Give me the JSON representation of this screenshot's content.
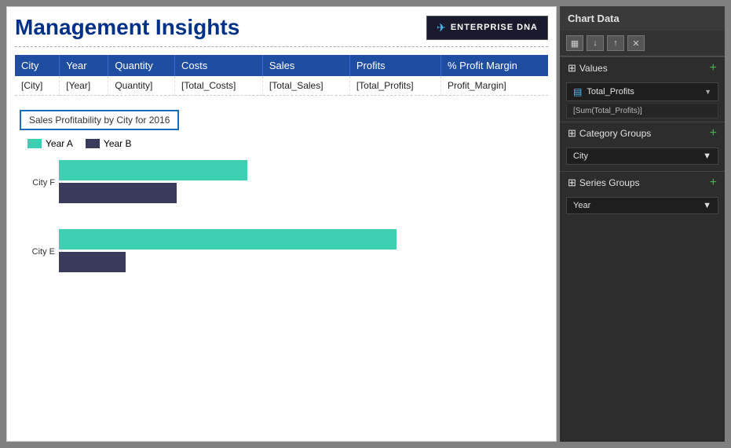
{
  "header": {
    "title": "Management Insights",
    "logo_text": "ENTERPRISE DNA"
  },
  "table": {
    "columns": [
      "City",
      "Year",
      "Quantity",
      "Costs",
      "Sales",
      "Profits",
      "% Profit Margin"
    ],
    "rows": [
      [
        "[City]",
        "[Year]",
        "Quantity]",
        "[Total_Costs]",
        "[Total_Sales]",
        "[Total_Profits]",
        "Profit_Margin]"
      ]
    ]
  },
  "chart": {
    "title": "Sales Profitability by City for 2016",
    "legend": {
      "year_a_label": "Year A",
      "year_b_label": "Year B",
      "year_a_color": "#3ecfb2",
      "year_b_color": "#3a3a5c"
    },
    "bars": [
      {
        "label": "City F",
        "year_a_width": 60,
        "year_b_width": 38
      },
      {
        "label": "City E",
        "year_a_width": 90,
        "year_b_width": 22
      }
    ]
  },
  "sidebar": {
    "header": "Chart Data",
    "toolbar": {
      "grid_icon": "▦",
      "down_icon": "↓",
      "up_icon": "↑",
      "delete_icon": "✕"
    },
    "values_section": {
      "label": "Values",
      "field_name": "Total_Profits",
      "field_sub": "[Sum(Total_Profits)]"
    },
    "category_section": {
      "label": "Category Groups",
      "field_name": "City"
    },
    "series_section": {
      "label": "Series Groups",
      "field_name": "Year"
    }
  }
}
